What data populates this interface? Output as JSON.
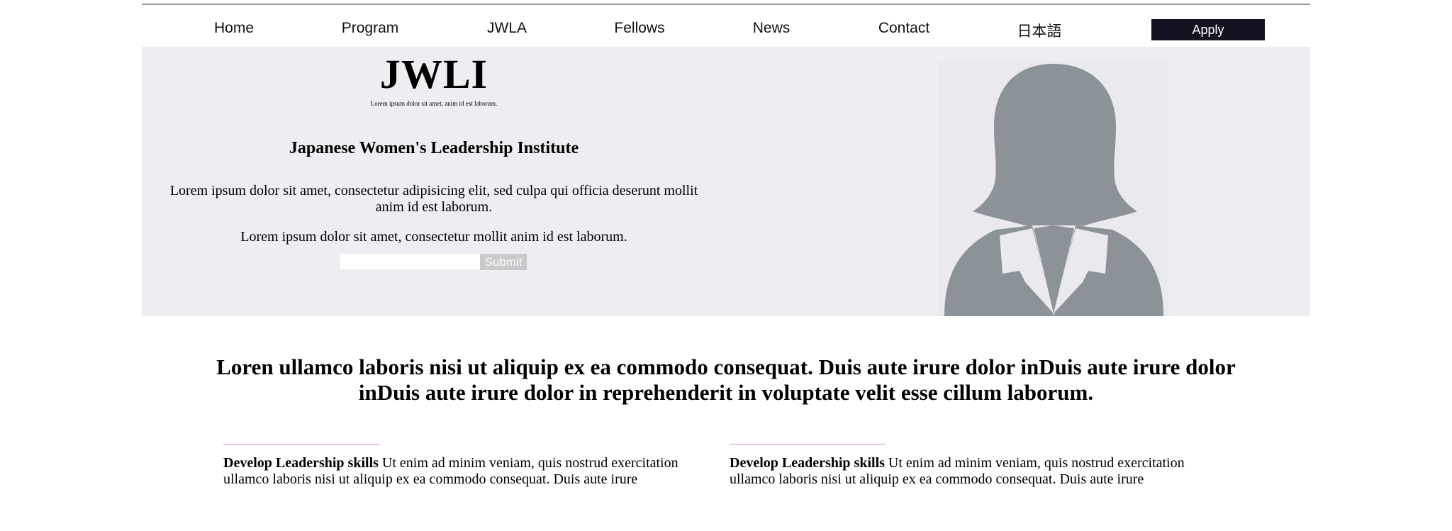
{
  "nav": {
    "items": [
      {
        "label": "Home",
        "name": "nav-home"
      },
      {
        "label": "Program",
        "name": "nav-program"
      },
      {
        "label": "JWLA",
        "name": "nav-jwla"
      },
      {
        "label": "Fellows",
        "name": "nav-fellows"
      },
      {
        "label": "News",
        "name": "nav-news"
      },
      {
        "label": "Contact",
        "name": "nav-contact"
      },
      {
        "label": "日本語",
        "name": "nav-japanese"
      }
    ],
    "apply_label": "Apply"
  },
  "hero": {
    "logo_title": "JWLI",
    "logo_tagline": "Lorem ipsum dolor sit amet, anim id est laborum.",
    "heading": "Japanese Women's Leadership Institute",
    "paragraph1": "Lorem ipsum dolor sit amet, consectetur adipisicing elit, sed culpa qui officia deserunt mollit anim id est laborum.",
    "paragraph2": "Lorem ipsum dolor sit amet, consectetur mollit anim id est laborum.",
    "input_value": "",
    "input_placeholder": "",
    "submit_label": "Submit",
    "portrait_icon": "person-silhouette-icon"
  },
  "lead": "Loren ullamco laboris nisi ut aliquip ex ea commodo consequat. Duis aute irure dolor inDuis aute irure dolor inDuis aute irure dolor in reprehenderit in voluptate velit esse cillum laborum.",
  "features": [
    {
      "title": "Develop Leadership skills",
      "text": " Ut enim ad minim veniam, quis nostrud exercitation ullamco laboris nisi ut aliquip ex ea commodo consequat. Duis aute irure"
    },
    {
      "title": "Develop Leadership skills",
      "text": " Ut enim ad minim veniam, quis nostrud exercitation ullamco laboris nisi ut aliquip ex ea commodo consequat. Duis aute irure"
    }
  ],
  "colors": {
    "hero_bg": "#eeeef2",
    "apply_bg": "#151320",
    "silhouette": "#8b9298",
    "accent_rule": "#d99a9a"
  }
}
